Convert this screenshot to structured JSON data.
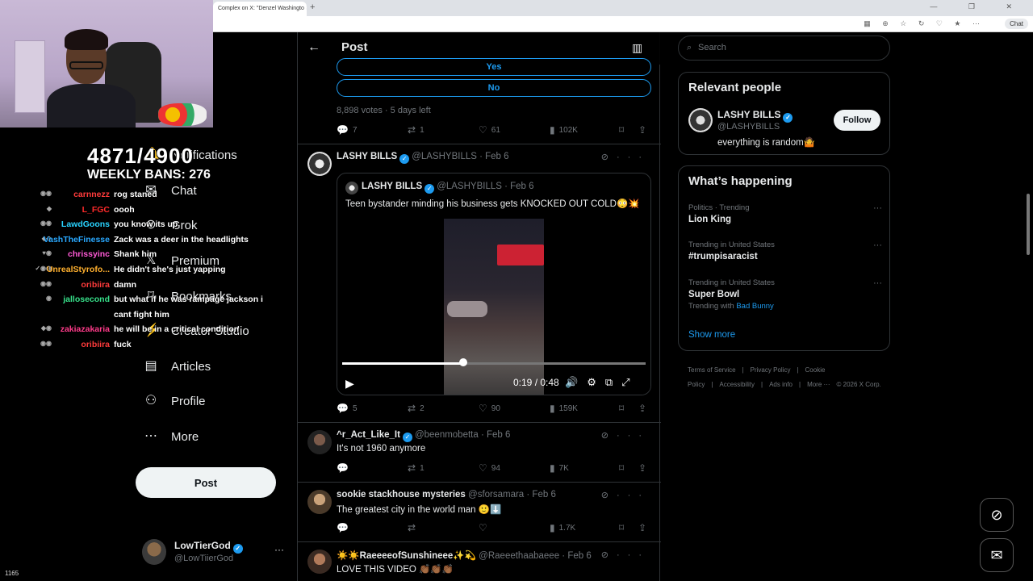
{
  "browser": {
    "tab_title": "Complex on X: \"Denzel Washingto",
    "tab_close": "✕",
    "new_tab": "+",
    "window_controls": "—  ❐  ✕",
    "chat_label": "Chat",
    "addr_icons": "▦ ⊕ ☆ ↻ ♡ ★ ⋯"
  },
  "overlay": {
    "ban_count": "4871/4900",
    "weekly_bans": "WEEKLY BANS: 276",
    "viewer_count": "1165",
    "chat": [
      {
        "badges": "◉◉",
        "user": "carnnezz",
        "color": "#ff3b3b",
        "msg": "rog staned"
      },
      {
        "badges": "◆",
        "user": "L_FGC",
        "color": "#ff2a2a",
        "msg": "oooh"
      },
      {
        "badges": "◉◉",
        "user": "LawdGoons",
        "color": "#29d3ff",
        "msg": "you know its up"
      },
      {
        "badges": "◆◆",
        "user": "VashTheFinesse",
        "color": "#29a8ff",
        "msg": "Zack was a deer in the headlights"
      },
      {
        "badges": "♥◉",
        "user": "chrissyinc",
        "color": "#ff5ad6",
        "msg": "Shank him"
      },
      {
        "badges": "✓◉◉",
        "user": "UnrealStyrofo...",
        "color": "#ffb02e",
        "msg": "He didn't she's just yapping"
      },
      {
        "badges": "◉◉",
        "user": "oribiira",
        "color": "#ff3b3b",
        "msg": "damn"
      },
      {
        "badges": "◉",
        "user": "jallosecond",
        "color": "#37e08a",
        "msg": "but what if he was rampage jackson i"
      },
      {
        "badges": "",
        "user": "",
        "color": "#fff",
        "msg": "cant fight him"
      },
      {
        "badges": "◆◉",
        "user": "zakiazakaria",
        "color": "#ff3b8a",
        "msg": "he will be in a critical condition"
      },
      {
        "badges": "◉◉",
        "user": "oribiira",
        "color": "#ff3b3b",
        "msg": "fuck"
      }
    ]
  },
  "nav": {
    "items": [
      {
        "icon": "bell-icon",
        "glyph": "🔔",
        "label": "Notifications"
      },
      {
        "icon": "mail-icon",
        "glyph": "✉",
        "label": "Chat"
      },
      {
        "icon": "grok-icon",
        "glyph": "⊘",
        "label": "Grok"
      },
      {
        "icon": "x-logo-icon",
        "glyph": "𝕏",
        "label": "Premium"
      },
      {
        "icon": "bookmark-icon",
        "glyph": "⌑",
        "label": "Bookmarks"
      },
      {
        "icon": "bolt-icon",
        "glyph": "⚡",
        "label": "Creator Studio"
      },
      {
        "icon": "article-icon",
        "glyph": "▤",
        "label": "Articles"
      },
      {
        "icon": "person-icon",
        "glyph": "⚇",
        "label": "Profile"
      },
      {
        "icon": "more-circle-icon",
        "glyph": "⋯",
        "label": "More"
      }
    ],
    "post_button": "Post",
    "account": {
      "name": "LowTierGod",
      "handle": "@LowTiierGod",
      "more": "···"
    }
  },
  "center": {
    "header_title": "Post",
    "back_glyph": "←",
    "reader_glyph": "▥",
    "poll": {
      "options": [
        "Yes",
        "No"
      ],
      "meta": "8,898 votes · 5 days left",
      "stats": {
        "replies": "7",
        "reposts": "1",
        "likes": "61",
        "views": "102K"
      }
    },
    "tweets": [
      {
        "name": "LASHY BILLS",
        "handle": "@LASHYBILLS · Feb 6",
        "text": "",
        "stats": {
          "replies": "5",
          "reposts": "2",
          "likes": "90",
          "views": "159K"
        },
        "quote": {
          "name": "LASHY BILLS",
          "handle": "@LASHYBILLS · Feb 6",
          "text": "Teen bystander minding his business gets KNOCKED OUT COLD😳💥",
          "video": {
            "time": "0:19 / 0:48",
            "progress": 0.4
          }
        }
      },
      {
        "name": "^r_Act_Like_It",
        "handle": "@beenmobetta · Feb 6",
        "text": "It's not 1960 anymore",
        "stats": {
          "replies": "",
          "reposts": "1",
          "likes": "94",
          "views": "7K"
        }
      },
      {
        "name": "sookie stackhouse mysteries",
        "handle": "@sforsamara · Feb 6",
        "text": "The greatest city in the world man 🙂⬇️",
        "stats": {
          "replies": "",
          "reposts": "",
          "likes": "",
          "views": "1.7K"
        }
      },
      {
        "name": "☀️☀️RaeeeeofSunshineee✨💫",
        "handle": "@Raeeethaabaeee · Feb 6",
        "text": "LOVE THIS VIDEO 👏🏾👏🏾👏🏾"
      }
    ]
  },
  "right": {
    "search_placeholder": "Search",
    "relevant": {
      "title": "Relevant people",
      "name": "LASHY BILLS",
      "handle": "@LASHYBILLS",
      "bio": "everything is random🤷",
      "follow": "Follow"
    },
    "happening": {
      "title": "What’s happening",
      "trends": [
        {
          "category": "Politics · Trending",
          "name": "Lion King",
          "with": ""
        },
        {
          "category": "Trending in United States",
          "name": "#trumpisaracist",
          "with": ""
        },
        {
          "category": "Trending in United States",
          "name": "Super Bowl",
          "with_label": "Trending with",
          "with": "Bad Bunny"
        }
      ],
      "show_more": "Show more"
    },
    "footer": [
      "Terms of Service",
      "|",
      "Privacy Policy",
      "|",
      "Cookie Policy",
      "|",
      "Accessibility",
      "|",
      "Ads info",
      "|",
      "More ···",
      "© 2026 X Corp."
    ]
  },
  "colors": {
    "accent": "#1d9bf0",
    "bg": "#000000",
    "border": "#2f3336",
    "muted": "#71767b"
  }
}
